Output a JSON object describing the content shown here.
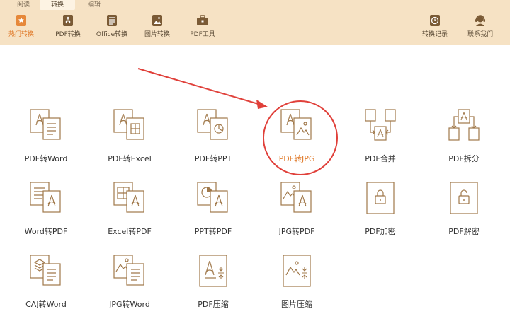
{
  "tabs": [
    "阅读",
    "转换",
    "编辑"
  ],
  "toolbar": {
    "left_items": [
      {
        "label": "热门转换",
        "icon": "star-doc-icon"
      },
      {
        "label": "PDF转换",
        "icon": "pdf-doc-icon"
      },
      {
        "label": "Office转换",
        "icon": "office-doc-icon"
      },
      {
        "label": "图片转换",
        "icon": "image-doc-icon"
      },
      {
        "label": "PDF工具",
        "icon": "toolbox-icon"
      }
    ],
    "right_items": [
      {
        "label": "转换记录",
        "icon": "clock-icon"
      },
      {
        "label": "联系我们",
        "icon": "headset-icon"
      }
    ]
  },
  "colors": {
    "accent": "#e07a2a",
    "toolbar_bg": "#f6e2c4",
    "icon_stroke": "#a0784a",
    "highlight_ring": "#e0403a"
  },
  "tools": [
    {
      "label": "PDF转Word",
      "icon": "pdf-to-word-icon"
    },
    {
      "label": "PDF转Excel",
      "icon": "pdf-to-excel-icon"
    },
    {
      "label": "PDF转PPT",
      "icon": "pdf-to-ppt-icon"
    },
    {
      "label": "PDF转JPG",
      "icon": "pdf-to-jpg-icon"
    },
    {
      "label": "PDF合并",
      "icon": "pdf-merge-icon"
    },
    {
      "label": "PDF拆分",
      "icon": "pdf-split-icon"
    },
    {
      "label": "Word转PDF",
      "icon": "word-to-pdf-icon"
    },
    {
      "label": "Excel转PDF",
      "icon": "excel-to-pdf-icon"
    },
    {
      "label": "PPT转PDF",
      "icon": "ppt-to-pdf-icon"
    },
    {
      "label": "JPG转PDF",
      "icon": "jpg-to-pdf-icon"
    },
    {
      "label": "PDF加密",
      "icon": "pdf-encrypt-icon"
    },
    {
      "label": "PDF解密",
      "icon": "pdf-decrypt-icon"
    },
    {
      "label": "CAJ转Word",
      "icon": "caj-to-word-icon"
    },
    {
      "label": "JPG转Word",
      "icon": "jpg-to-word-icon"
    },
    {
      "label": "PDF压缩",
      "icon": "pdf-compress-icon"
    },
    {
      "label": "图片压缩",
      "icon": "image-compress-icon"
    }
  ]
}
